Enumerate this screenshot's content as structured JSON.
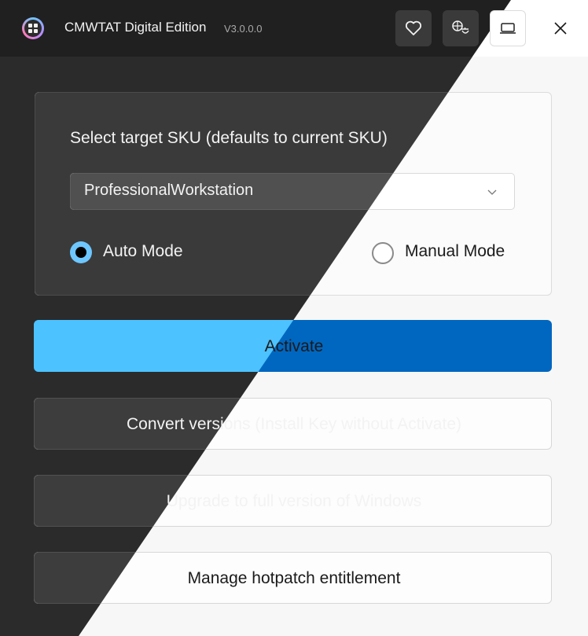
{
  "window": {
    "title": "CMWTAT Digital Edition",
    "version": "V3.0.0.0",
    "buttons": [
      "heart-icon",
      "translate-icon",
      "laptop-icon",
      "close-icon"
    ],
    "theme_dark_color": "#2b2b2b",
    "theme_light_color": "#f7f7f7"
  },
  "sku": {
    "label": "Select target SKU (defaults to current SKU)",
    "selected": "ProfessionalWorkstation"
  },
  "mode": {
    "auto_label": "Auto Mode",
    "manual_label": "Manual Mode",
    "selected": "Auto Mode"
  },
  "actions": {
    "activate": "Activate",
    "convert": "Convert versions (Install Key without Activate)",
    "upgrade": "Upgrade to full version of Windows",
    "hotpatch": "Manage hotpatch entitlement"
  },
  "colors": {
    "accent_dark": "#4cc2ff",
    "accent_light": "#0067c0"
  }
}
